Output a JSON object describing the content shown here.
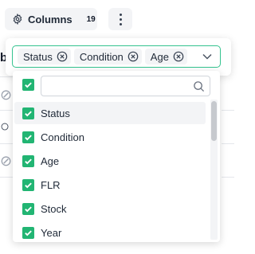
{
  "toolbar": {
    "columns_label": "Columns",
    "columns_count": "19",
    "columns_icon": "gear-icon",
    "more_icon": "kebab-icon"
  },
  "background": {
    "partial_letter": "b"
  },
  "column_picker": {
    "selected_chips": [
      {
        "label": "Status"
      },
      {
        "label": "Condition"
      },
      {
        "label": "Age"
      }
    ],
    "search_placeholder": "",
    "search_value": "",
    "options": [
      {
        "label": "Status",
        "checked": true,
        "highlighted": true
      },
      {
        "label": "Condition",
        "checked": true
      },
      {
        "label": "Age",
        "checked": true
      },
      {
        "label": "FLR",
        "checked": true
      },
      {
        "label": "Stock",
        "checked": true
      },
      {
        "label": "Year",
        "checked": true
      }
    ],
    "select_all_checked": true
  },
  "colors": {
    "accent": "#22b573",
    "focus_border": "#34c38f",
    "chip_bg": "#f3f4f6"
  }
}
